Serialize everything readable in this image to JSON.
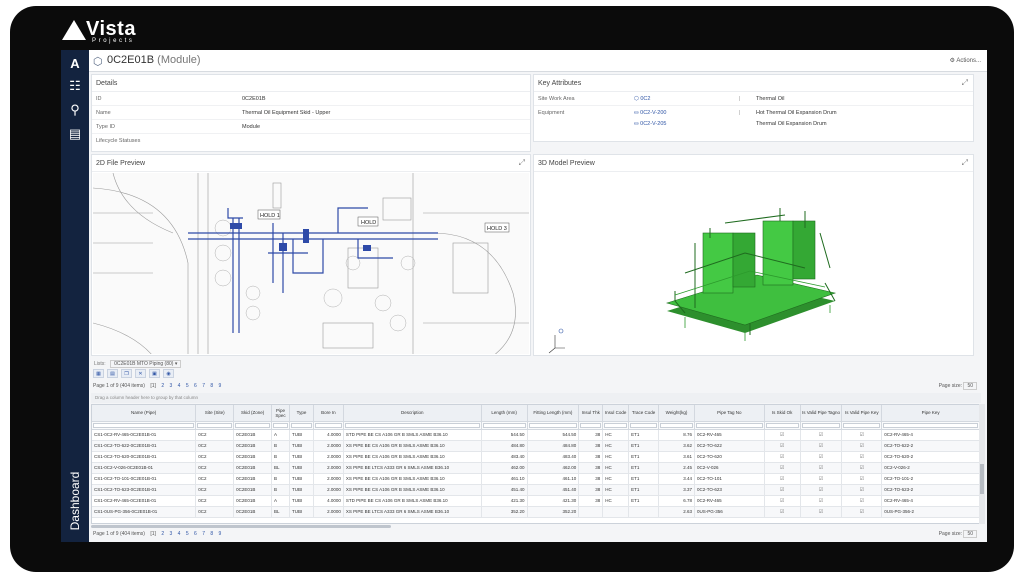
{
  "brand": {
    "name": "Vista",
    "sub": "Projects"
  },
  "header": {
    "title": "0C2E01B",
    "type": "(Module)",
    "actions": "Actions..."
  },
  "details": {
    "title": "Details",
    "rows": [
      {
        "label": "ID",
        "value": "0C2E01B"
      },
      {
        "label": "Name",
        "value": "Thermal Oil Equipment Skid - Upper"
      },
      {
        "label": "Type ID",
        "value": "Module"
      },
      {
        "label": "Lifecycle Statuses",
        "value": ""
      }
    ]
  },
  "key_attributes": {
    "title": "Key Attributes",
    "site_label": "Site Work Area",
    "site_value": "0C2",
    "site_desc": "Thermal Oil",
    "equip_label": "Equipment",
    "equipment": [
      {
        "tag": "0C2-V-200",
        "desc": "Hot Thermal Oil Expansion Drum"
      },
      {
        "tag": "0C2-V-205",
        "desc": "Thermal Oil Expansion Drum"
      }
    ]
  },
  "preview2d": {
    "title": "2D File Preview",
    "labels": [
      "HOLD 1",
      "HOLD",
      "HOLD 3"
    ]
  },
  "preview3d": {
    "title": "3D Model Preview"
  },
  "lists": {
    "label": "Lists:",
    "selected": "0C2E01B MTO Piping (80)"
  },
  "pager_top": {
    "text": "Page 1 of 9 (404 items)",
    "current": "[1]",
    "pages": [
      "2",
      "3",
      "4",
      "5",
      "6",
      "7",
      "8",
      "9"
    ],
    "size_label": "Page size:",
    "size": "50"
  },
  "pager_bottom": {
    "text": "Page 1 of 9 (404 items)",
    "current": "[1]",
    "pages": [
      "2",
      "3",
      "4",
      "5",
      "6",
      "7",
      "8",
      "9"
    ],
    "size_label": "Page size:",
    "size": "50"
  },
  "group_hint": "Drag a column header here to group by that column",
  "table": {
    "columns": [
      "Name (Pipe)",
      "Site (Site)",
      "Skid (Zone)",
      "Pipe Spec",
      "Type",
      "Bore In",
      "Description",
      "Length (mm)",
      "Fitting Length (mm)",
      "Insul Thk",
      "Insul Code",
      "Trace Code",
      "Weight(kg)",
      "Pipe Tag No",
      "Is Skid Ok",
      "Is Valid Pipe Tagno",
      "Is Valid Pipe Key",
      "Pipe Key"
    ],
    "rows": [
      [
        "CS1-0C2-RV-465-0C2E01B-01",
        "0C2",
        "0C2E01B",
        "A",
        "TUBI",
        "4.0000",
        "STD PIPE BE CS A106 GR B SMLS ASME B36.10",
        "544.50",
        "544.50",
        "38",
        "HC",
        "ET1",
        "8.76",
        "0C2-RV-465",
        "☑",
        "☑",
        "☑",
        "0C2-RV-465-4"
      ],
      [
        "CS1-0C2-TO-622-0C2E01B-01",
        "0C2",
        "0C2E01B",
        "B",
        "TUBI",
        "2.0000",
        "XS PIPE BE CS A106 GR B SMLS ASME B36.10",
        "484.80",
        "484.80",
        "38",
        "HC",
        "ET1",
        "3.62",
        "0C2-TO-622",
        "☑",
        "☑",
        "☑",
        "0C2-TO-622-2"
      ],
      [
        "CS1-0C2-TO-620-0C2E01B-01",
        "0C2",
        "0C2E01B",
        "B",
        "TUBI",
        "2.0000",
        "XS PIPE BE CS A106 GR B SMLS ASME B36.10",
        "483.40",
        "483.40",
        "38",
        "HC",
        "ET1",
        "3.61",
        "0C2-TO-620",
        "☑",
        "☑",
        "☑",
        "0C2-TO-620-2"
      ],
      [
        "CS1-0C2-V-026-0C2E01B-01",
        "0C2",
        "0C2E01B",
        "BL",
        "TUBI",
        "2.0000",
        "XS PIPE BE LTCS A333 GR 6 SMLS ASME B36.10",
        "462.00",
        "462.00",
        "38",
        "HC",
        "ET1",
        "2.45",
        "0C2-V-026",
        "☑",
        "☑",
        "☑",
        "0C2-V-026-2"
      ],
      [
        "CS1-0C2-TO-101-0C2E01B-01",
        "0C2",
        "0C2E01B",
        "B",
        "TUBI",
        "2.0000",
        "XS PIPE BE CS A106 GR B SMLS ASME B36.10",
        "461.10",
        "461.10",
        "38",
        "HC",
        "ET1",
        "3.44",
        "0C2-TO-101",
        "☑",
        "☑",
        "☑",
        "0C2-TO-101-2"
      ],
      [
        "CS1-0C2-TO-623-0C2E01B-01",
        "0C2",
        "0C2E01B",
        "B",
        "TUBI",
        "2.0000",
        "XS PIPE BE CS A106 GR B SMLS ASME B36.10",
        "451.40",
        "451.40",
        "38",
        "HC",
        "ET1",
        "3.37",
        "0C2-TO-623",
        "☑",
        "☑",
        "☑",
        "0C2-TO-623-2"
      ],
      [
        "CS1-0C2-RV-465-0C2E01B-01",
        "0C2",
        "0C2E01B",
        "A",
        "TUBI",
        "4.0000",
        "STD PIPE BE CS A106 GR B SMLS ASME B36.10",
        "421.30",
        "421.30",
        "38",
        "HC",
        "ET1",
        "6.78",
        "0C2-RV-465",
        "☑",
        "☑",
        "☑",
        "0C2-RV-465-4"
      ],
      [
        "CS1-0US-PG-356-0C2E01B-01",
        "0C2",
        "0C2E01B",
        "BL",
        "TUBI",
        "2.0000",
        "XS PIPE BE LTCS A333 GR 6 SMLS ASME B36.10",
        "352.20",
        "352.20",
        "",
        "",
        "",
        "2.63",
        "0US-PG-356",
        "☑",
        "☑",
        "☑",
        "0US-PG-356-2"
      ]
    ]
  }
}
